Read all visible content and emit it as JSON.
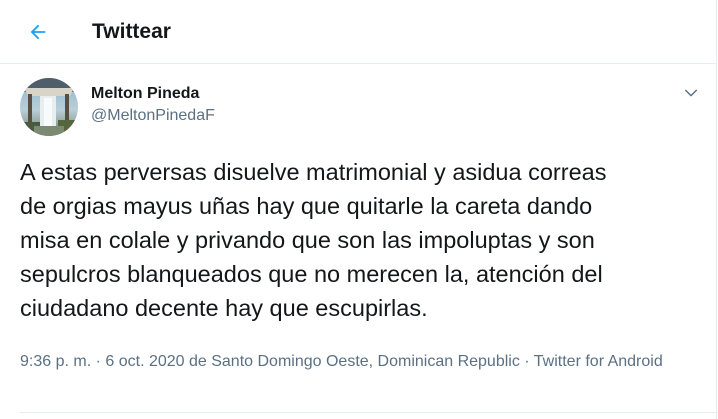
{
  "header": {
    "title": "Twittear",
    "back_icon": "arrow-left-icon",
    "accent_color": "#1da1f2"
  },
  "tweet": {
    "author": {
      "name": "Melton Pineda",
      "handle": "@MeltonPinedaF",
      "avatar": "profile-photo"
    },
    "more_icon": "chevron-down-icon",
    "text": "A estas perversas disuelve matrimonial y asidua correas\nde orgias mayus uñas hay que quitarle la careta dando\nmisa en colale y privando que son las impoluptas y son\nsepulcros blanqueados que no merecen la, atención del\nciudadano decente hay que escupirlas.",
    "meta": {
      "time": "9:36 p. m.",
      "sep1": " · ",
      "date": "6 oct. 2020",
      "location_prefix": " de ",
      "location": "Santo Domingo Oeste, Dominican Republic",
      "sep2": " · ",
      "source": "Twitter for Android"
    }
  }
}
